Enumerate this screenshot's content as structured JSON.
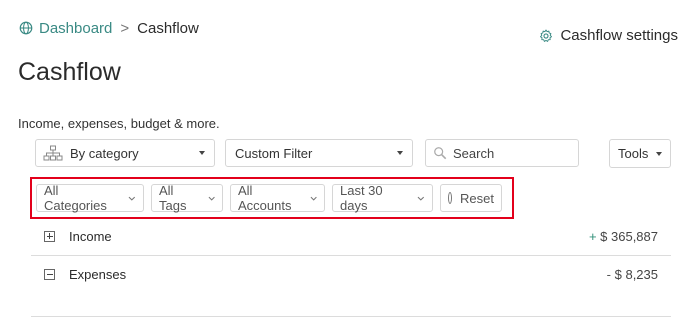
{
  "breadcrumb": {
    "parent": "Dashboard",
    "separator": ">",
    "current": "Cashflow"
  },
  "settings_link": "Cashflow settings",
  "page": {
    "title": "Cashflow",
    "subtitle": "Income, expenses, budget & more."
  },
  "toolbar": {
    "group_by": "By category",
    "filter": "Custom Filter",
    "search_placeholder": "Search",
    "tools": "Tools"
  },
  "filters": {
    "categories": "All Categories",
    "tags": "All Tags",
    "accounts": "All Accounts",
    "date_range": "Last 30 days",
    "reset": "Reset"
  },
  "rows": [
    {
      "label": "Income",
      "sign": "+",
      "amount": "$ 365,887"
    },
    {
      "label": "Expenses",
      "sign": "-",
      "amount": "$ 8,235"
    }
  ],
  "colors": {
    "link": "#3a8a84",
    "highlight": "#e3001b",
    "positive": "#2f8f78"
  }
}
